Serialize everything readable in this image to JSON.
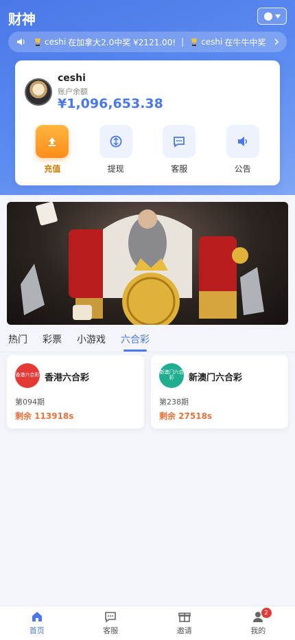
{
  "header": {
    "title": "财神",
    "lang_icon": "globe-icon"
  },
  "marquee": {
    "items": [
      {
        "user": "ceshi",
        "text": "在加拿大2.0中奖 ¥2121.00!"
      },
      {
        "user": "ceshi",
        "text": "在牛牛中奖"
      }
    ],
    "separator": "|"
  },
  "wallet": {
    "username": "ceshi",
    "balance_label": "账户余额",
    "balance": "¥1,096,653.38"
  },
  "actions": [
    {
      "label": "充值",
      "icon": "upload-icon"
    },
    {
      "label": "提现",
      "icon": "withdraw-icon"
    },
    {
      "label": "客服",
      "icon": "chat-icon"
    },
    {
      "label": "公告",
      "icon": "speaker-icon"
    }
  ],
  "tabs": [
    "热门",
    "彩票",
    "小游戏",
    "六合彩"
  ],
  "active_tab": "六合彩",
  "games": [
    {
      "name": "香港六合彩",
      "logo_text": "香港六合彩",
      "period": "第094期",
      "remain": "剩余 113918s",
      "logo_color": "#e53935"
    },
    {
      "name": "新澳门六合彩",
      "logo_text": "新澳门六合彩",
      "period": "第238期",
      "remain": "剩余 27518s",
      "logo_color": "#1fae8f"
    }
  ],
  "nav": [
    {
      "label": "首页",
      "icon": "home-icon"
    },
    {
      "label": "客服",
      "icon": "chat-icon"
    },
    {
      "label": "邀请",
      "icon": "gift-icon"
    },
    {
      "label": "我的",
      "icon": "user-icon",
      "badge": "2"
    }
  ],
  "colors": {
    "accent": "#4a78e8",
    "orange": "#ff8c1a",
    "remain": "#e8743b"
  }
}
